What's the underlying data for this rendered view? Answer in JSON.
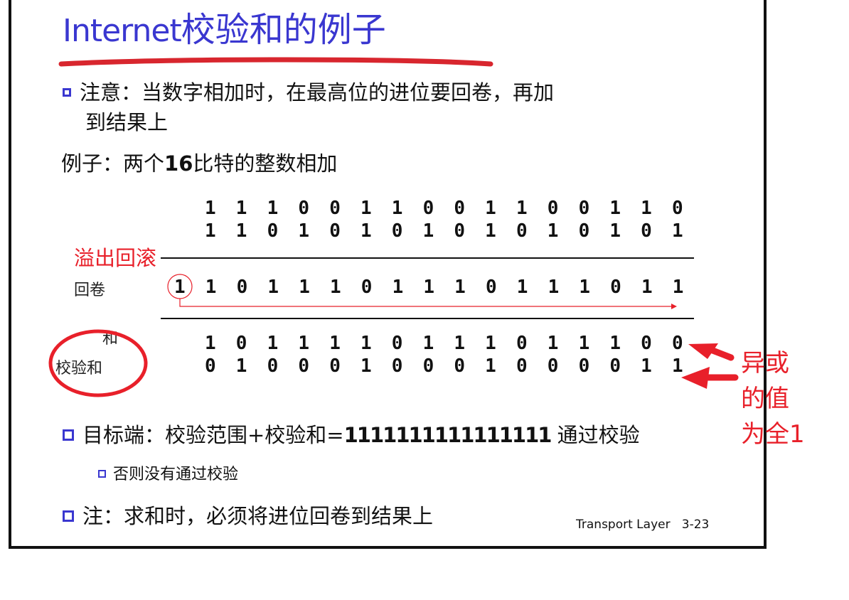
{
  "slide": {
    "title_en": "Internet",
    "title_zh": "校验和的例子",
    "note_line1": "注意：当数字相加时，在最高位的进位要回卷，再加",
    "note_line2": "到结果上",
    "example_prefix": "例子：两个",
    "example_num": "16",
    "example_suffix": "比特的整数相加",
    "overflow_label": "溢出回滚",
    "wrap_label": "回卷",
    "sum_label": "和",
    "checksum_label": "校验和",
    "xor_annotation": [
      "异或",
      "的值",
      "为全1"
    ],
    "dest_prefix": "目标端：校验范围+校验和=",
    "dest_ones": "1111111111111111",
    "dest_suffix": " 通过校验",
    "sub_bullet": "否则没有通过校验",
    "final_note": "注：求和时，必须将进位回卷到结果上",
    "footer": "Transport Layer   3-23"
  },
  "computation": {
    "operand1": [
      "1",
      "1",
      "1",
      "0",
      "0",
      "1",
      "1",
      "0",
      "0",
      "1",
      "1",
      "0",
      "0",
      "1",
      "1",
      "0"
    ],
    "operand2": [
      "1",
      "1",
      "0",
      "1",
      "0",
      "1",
      "0",
      "1",
      "0",
      "1",
      "0",
      "1",
      "0",
      "1",
      "0",
      "1"
    ],
    "wraparound": [
      "1",
      "1",
      "0",
      "1",
      "1",
      "1",
      "0",
      "1",
      "1",
      "1",
      "0",
      "1",
      "1",
      "1",
      "0",
      "1",
      "1"
    ],
    "sum": [
      "1",
      "0",
      "1",
      "1",
      "1",
      "1",
      "0",
      "1",
      "1",
      "1",
      "0",
      "1",
      "1",
      "1",
      "0",
      "0"
    ],
    "checksum": [
      "0",
      "1",
      "0",
      "0",
      "0",
      "1",
      "0",
      "0",
      "0",
      "1",
      "0",
      "0",
      "0",
      "0",
      "1",
      "1"
    ],
    "carry_bit": "1"
  },
  "colors": {
    "title": "#3a37d0",
    "annotation_red": "#e8202a",
    "text": "#111111"
  }
}
